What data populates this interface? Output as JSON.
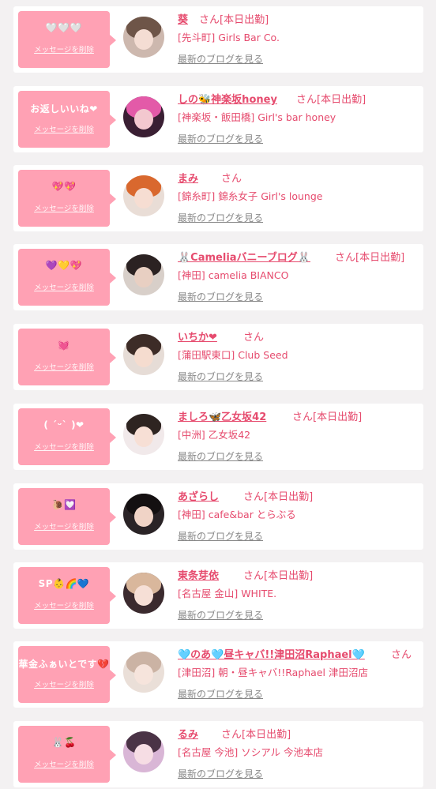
{
  "delete_label": "メッセージを削除",
  "blog_label": "最新のブログを見る",
  "colors": {
    "accent": "#e64b6e",
    "bubble": "#ffa1b4",
    "card": "#ffffff",
    "page": "#f3f1f2"
  },
  "entries": [
    {
      "message": "🤍🤍🤍",
      "name": "葵",
      "suffix": "さん[本日出勤]",
      "shop": "[先斗町] Girls Bar Co."
    },
    {
      "message": "お返しいいね‪‪❤︎‬",
      "name": "しの🐝神楽坂honey",
      "suffix": "さん[本日出勤]",
      "shop": "[神楽坂・飯田橋] Girl's bar honey"
    },
    {
      "message": "💖💖",
      "name": "まみ",
      "suffix": "さん",
      "shop": "[錦糸町] 錦糸女子 Girl's lounge"
    },
    {
      "message": "💜💛💖",
      "name": "🐰Cameliaバニーブログ🐰",
      "suffix": "さん[本日出勤]",
      "shop": "[神田] camelia BIANCO"
    },
    {
      "message": "💓",
      "name": "いちか❤",
      "suffix": "さん",
      "shop": "[蒲田駅東口] Club Seed"
    },
    {
      "message": "( ˊᵕˋ )❤",
      "name": "ましろ🦋乙女坂42",
      "suffix": "さん[本日出勤]",
      "shop": "[中洲] 乙女坂42"
    },
    {
      "message": "🐌💟",
      "name": "あざらし",
      "suffix": "さん[本日出勤]",
      "shop": "[神田] cafe&bar とらぶる"
    },
    {
      "message": "SP👶🌈💙",
      "name": "東条芽依",
      "suffix": "さん[本日出勤]",
      "shop": "[名古屋 金山] WHITE."
    },
    {
      "message": "華金ふぁいとです💔",
      "name": "🩵のあ🩵昼キャバ!!津田沼Raphael🩵",
      "suffix": "さん",
      "shop": "[津田沼] 朝・昼キャバ!!Raphael 津田沼店"
    },
    {
      "message": "🐰🍒",
      "name": "るみ",
      "suffix": "さん[本日出勤]",
      "shop": "[名古屋 今池] ソシアル 今池本店"
    }
  ]
}
